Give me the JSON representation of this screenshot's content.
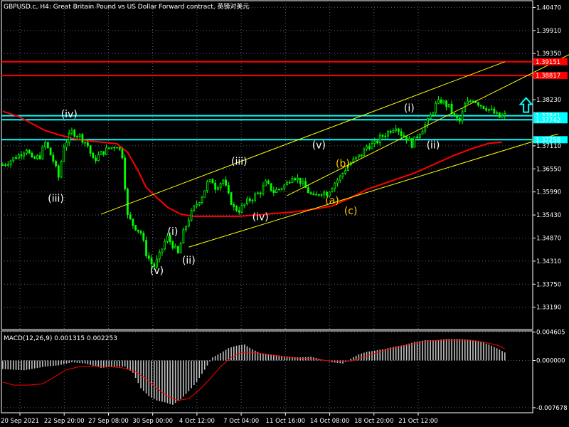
{
  "header": {
    "title": "GBPUSD.c, H4:  Great Britain Pound vs US Dollar Forward contract, 英镑对美元"
  },
  "macd_panel": {
    "label": "MACD(12,26,9) 0.001315 0.002253"
  },
  "colors": {
    "background": "#000000",
    "grid": "#4f5f7f",
    "candles": "#00ff00",
    "moving_average": "#ff0000",
    "channel_lines": "#ffff00",
    "level_red": "#ff0000",
    "level_cyan": "#00ffff",
    "wave_white": "#ffffff",
    "wave_yellow": "#ffcc00",
    "macd_histogram": "#c0c0c0",
    "macd_signal": "#ff0000",
    "arrow": "#00ffff"
  },
  "chart_data": [
    {
      "type": "candlestick",
      "symbol": "GBPUSD.c",
      "timeframe": "H4",
      "title": "GBPUSD.c, H4:  Great Britain Pound vs US Dollar Forward contract, 英镑对美元",
      "x_tick_labels": [
        "20 Sep 2021",
        "22 Sep 20:00",
        "27 Sep 08:00",
        "30 Sep 00:00",
        "4 Oct 12:00",
        "7 Oct 04:00",
        "11 Oct 16:00",
        "14 Oct 08:00",
        "18 Oct 20:00",
        "21 Oct 12:00"
      ],
      "y_tick_labels": [
        "1.40470",
        "1.39910",
        "1.39350",
        "1.38230",
        "1.37110",
        "1.36550",
        "1.35990",
        "1.35430",
        "1.34870",
        "1.34310",
        "1.33750",
        "1.33190"
      ],
      "ylim": [
        1.3265,
        1.4065
      ],
      "close_path": [
        [
          0,
          1.3665
        ],
        [
          3,
          1.3676
        ],
        [
          6,
          1.3688
        ],
        [
          9,
          1.3705
        ],
        [
          11,
          1.3676
        ],
        [
          14,
          1.3686
        ],
        [
          16,
          1.3718
        ],
        [
          19,
          1.3675
        ],
        [
          21,
          1.3635
        ],
        [
          23,
          1.3712
        ],
        [
          26,
          1.3745
        ],
        [
          29,
          1.3735
        ],
        [
          32,
          1.3712
        ],
        [
          34,
          1.3675
        ],
        [
          37,
          1.3692
        ],
        [
          40,
          1.3705
        ],
        [
          43,
          1.3713
        ],
        [
          45,
          1.3688
        ],
        [
          47,
          1.354
        ],
        [
          49,
          1.352
        ],
        [
          52,
          1.35
        ],
        [
          54,
          1.345
        ],
        [
          56,
          1.3425
        ],
        [
          57,
          1.3418
        ],
        [
          59,
          1.3445
        ],
        [
          61,
          1.3478
        ],
        [
          62,
          1.3488
        ],
        [
          64,
          1.347
        ],
        [
          66,
          1.3448
        ],
        [
          68,
          1.35
        ],
        [
          70,
          1.3535
        ],
        [
          72,
          1.356
        ],
        [
          75,
          1.359
        ],
        [
          77,
          1.362
        ],
        [
          79,
          1.3625
        ],
        [
          80,
          1.3611
        ],
        [
          83,
          1.3628
        ],
        [
          85,
          1.359
        ],
        [
          87,
          1.356
        ],
        [
          89,
          1.3555
        ],
        [
          92,
          1.3575
        ],
        [
          95,
          1.359
        ],
        [
          97,
          1.36
        ],
        [
          99,
          1.362
        ],
        [
          102,
          1.36
        ],
        [
          105,
          1.361
        ],
        [
          107,
          1.362
        ],
        [
          109,
          1.364
        ],
        [
          112,
          1.3625
        ],
        [
          115,
          1.36
        ],
        [
          117,
          1.3585
        ],
        [
          120,
          1.36
        ],
        [
          122,
          1.3596
        ],
        [
          125,
          1.3622
        ],
        [
          127,
          1.3635
        ],
        [
          130,
          1.3665
        ],
        [
          132,
          1.3675
        ],
        [
          135,
          1.369
        ],
        [
          137,
          1.371
        ],
        [
          140,
          1.3715
        ],
        [
          142,
          1.373
        ],
        [
          145,
          1.3745
        ],
        [
          148,
          1.376
        ],
        [
          150,
          1.374
        ],
        [
          152,
          1.373
        ],
        [
          154,
          1.3715
        ],
        [
          157,
          1.3745
        ],
        [
          160,
          1.377
        ],
        [
          163,
          1.381
        ],
        [
          165,
          1.382
        ],
        [
          168,
          1.3805
        ],
        [
          170,
          1.378
        ],
        [
          172,
          1.377
        ],
        [
          174,
          1.381
        ],
        [
          177,
          1.3825
        ],
        [
          180,
          1.381
        ],
        [
          183,
          1.38
        ],
        [
          185,
          1.379
        ],
        [
          187,
          1.378
        ],
        [
          189,
          1.3785
        ]
      ],
      "moving_average": [
        [
          0,
          1.3795
        ],
        [
          6,
          1.3782
        ],
        [
          11,
          1.3765
        ],
        [
          16,
          1.3748
        ],
        [
          21,
          1.3738
        ],
        [
          27,
          1.3728
        ],
        [
          32,
          1.3723
        ],
        [
          37,
          1.372
        ],
        [
          43,
          1.3716
        ],
        [
          47,
          1.3695
        ],
        [
          51,
          1.365
        ],
        [
          54,
          1.361
        ],
        [
          58,
          1.3585
        ],
        [
          62,
          1.3562
        ],
        [
          67,
          1.3545
        ],
        [
          72,
          1.354
        ],
        [
          80,
          1.354
        ],
        [
          89,
          1.354
        ],
        [
          99,
          1.3545
        ],
        [
          109,
          1.355
        ],
        [
          118,
          1.3558
        ],
        [
          124,
          1.3565
        ],
        [
          131,
          1.3585
        ],
        [
          137,
          1.3605
        ],
        [
          146,
          1.3625
        ],
        [
          155,
          1.3645
        ],
        [
          162,
          1.3665
        ],
        [
          170,
          1.3688
        ],
        [
          177,
          1.3705
        ],
        [
          183,
          1.3717
        ],
        [
          188,
          1.372
        ]
      ],
      "channel_lines": [
        {
          "from": [
            37,
            1.3545
          ],
          "to": [
            189,
            1.3915
          ]
        },
        {
          "from": [
            70,
            1.3465
          ],
          "to": [
            209,
            1.374
          ]
        },
        {
          "from": [
            107,
            1.359
          ],
          "to": [
            214,
            1.3935
          ]
        }
      ],
      "horizontal_levels": [
        {
          "value": 1.39151,
          "label": "1.39151",
          "color": "#ff0000"
        },
        {
          "value": 1.38817,
          "label": "1.38817",
          "color": "#ff0000"
        },
        {
          "value": 1.37841,
          "label": "1.37841",
          "color": "#00ffff"
        },
        {
          "value": 1.37742,
          "label": "1.37742",
          "color": "#00ffff"
        },
        {
          "value": 1.37258,
          "label": "1.37258",
          "color": "#00ffff"
        }
      ],
      "wave_labels": [
        {
          "text": "(iv)",
          "x": 25,
          "y": 1.378,
          "color": "#ffffff"
        },
        {
          "text": "(iii)",
          "x": 20,
          "y": 1.3575,
          "color": "#ffffff"
        },
        {
          "text": "(i)",
          "x": 64,
          "y": 1.3495,
          "color": "#ffffff"
        },
        {
          "text": "(v)",
          "x": 58,
          "y": 1.34,
          "color": "#ffffff"
        },
        {
          "text": "(ii)",
          "x": 70,
          "y": 1.3425,
          "color": "#ffffff"
        },
        {
          "text": "(iii)",
          "x": 89,
          "y": 1.3665,
          "color": "#ffffff"
        },
        {
          "text": "(iv)",
          "x": 97,
          "y": 1.353,
          "color": "#ffffff"
        },
        {
          "text": "(v)",
          "x": 119,
          "y": 1.3705,
          "color": "#ffffff"
        },
        {
          "text": "(b)",
          "x": 128,
          "y": 1.366,
          "color": "#ffcc00"
        },
        {
          "text": "(a)",
          "x": 124,
          "y": 1.357,
          "color": "#ffcc00"
        },
        {
          "text": "(c)",
          "x": 131,
          "y": 1.3545,
          "color": "#ffcc00"
        },
        {
          "text": "(i)",
          "x": 153,
          "y": 1.3795,
          "color": "#ffffff"
        },
        {
          "text": "(ii)",
          "x": 162,
          "y": 1.3705,
          "color": "#ffffff"
        },
        {
          "text": "(iii)",
          "x": 216,
          "y": 1.3955,
          "color": "#ffffff"
        },
        {
          "text": "(iv)",
          "x": 228,
          "y": 1.381,
          "color": "#ffffff"
        }
      ],
      "arrow": {
        "x": 197,
        "y": 1.381,
        "direction": "up",
        "color": "#00ffff"
      }
    },
    {
      "type": "bar",
      "name": "MACD(12,26,9)",
      "main": 0.001315,
      "signal_value": 0.002253,
      "y_tick_labels": [
        "0.004605",
        "0.000000",
        "-0.007678"
      ],
      "ylim": [
        -0.0085,
        0.0048
      ],
      "histogram": [
        [
          0,
          -0.0014
        ],
        [
          8,
          -0.0016
        ],
        [
          16,
          -0.001
        ],
        [
          21,
          -0.0008
        ],
        [
          26,
          -0.0003
        ],
        [
          31,
          -0.0005
        ],
        [
          37,
          -0.0012
        ],
        [
          42,
          -0.001
        ],
        [
          46,
          -0.001
        ],
        [
          49,
          -0.002
        ],
        [
          52,
          -0.0045
        ],
        [
          55,
          -0.0058
        ],
        [
          58,
          -0.0065
        ],
        [
          61,
          -0.0068
        ],
        [
          64,
          -0.0072
        ],
        [
          67,
          -0.0063
        ],
        [
          70,
          -0.005
        ],
        [
          73,
          -0.0035
        ],
        [
          76,
          -0.0015
        ],
        [
          79,
          0.0005
        ],
        [
          82,
          0.0012
        ],
        [
          85,
          0.002
        ],
        [
          88,
          0.0024
        ],
        [
          91,
          0.0026
        ],
        [
          94,
          0.0018
        ],
        [
          97,
          0.0012
        ],
        [
          100,
          0.001
        ],
        [
          104,
          0.0008
        ],
        [
          108,
          0.0006
        ],
        [
          112,
          0.0005
        ],
        [
          116,
          0.0006
        ],
        [
          120,
          0.0002
        ],
        [
          124,
          -0.0003
        ],
        [
          128,
          -0.0005
        ],
        [
          131,
          0.0003
        ],
        [
          134,
          0.001
        ],
        [
          137,
          0.0014
        ],
        [
          140,
          0.0016
        ],
        [
          143,
          0.0018
        ],
        [
          147,
          0.0022
        ],
        [
          151,
          0.0025
        ],
        [
          155,
          0.003
        ],
        [
          159,
          0.0033
        ],
        [
          163,
          0.0033
        ],
        [
          167,
          0.0035
        ],
        [
          171,
          0.0035
        ],
        [
          175,
          0.0034
        ],
        [
          179,
          0.0032
        ],
        [
          183,
          0.0026
        ],
        [
          186,
          0.002
        ],
        [
          189,
          0.0013
        ]
      ],
      "signal": [
        [
          0,
          -0.0035
        ],
        [
          4,
          -0.004
        ],
        [
          10,
          -0.004
        ],
        [
          15,
          -0.0038
        ],
        [
          19,
          -0.0028
        ],
        [
          24,
          -0.0015
        ],
        [
          29,
          -0.001
        ],
        [
          34,
          -0.0009
        ],
        [
          40,
          -0.001
        ],
        [
          45,
          -0.0012
        ],
        [
          50,
          -0.0018
        ],
        [
          54,
          -0.003
        ],
        [
          58,
          -0.0045
        ],
        [
          62,
          -0.0058
        ],
        [
          66,
          -0.0065
        ],
        [
          70,
          -0.0062
        ],
        [
          74,
          -0.0048
        ],
        [
          78,
          -0.003
        ],
        [
          82,
          -0.001
        ],
        [
          86,
          0.0005
        ],
        [
          90,
          0.0013
        ],
        [
          94,
          0.0013
        ],
        [
          98,
          0.0011
        ],
        [
          103,
          0.0008
        ],
        [
          108,
          0.0005
        ],
        [
          114,
          0.0003
        ],
        [
          120,
          0.0001
        ],
        [
          125,
          -0.0002
        ],
        [
          131,
          -0.0001
        ],
        [
          136,
          0.0006
        ],
        [
          141,
          0.0013
        ],
        [
          146,
          0.0019
        ],
        [
          152,
          0.0025
        ],
        [
          158,
          0.003
        ],
        [
          164,
          0.0033
        ],
        [
          170,
          0.0033
        ],
        [
          176,
          0.0033
        ],
        [
          182,
          0.0029
        ],
        [
          186,
          0.0025
        ],
        [
          189,
          0.0019
        ]
      ]
    }
  ]
}
